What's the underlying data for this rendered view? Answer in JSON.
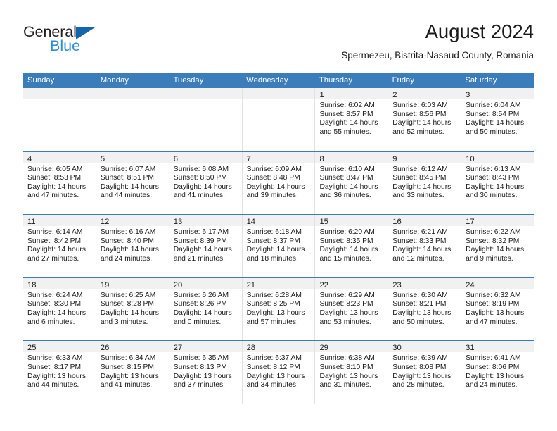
{
  "brand": {
    "name_primary": "General",
    "name_secondary": "Blue",
    "accent_color": "#2e8bd4",
    "triangle_color": "#1565ad"
  },
  "header": {
    "title": "August 2024",
    "subtitle": "Spermezeu, Bistrita-Nasaud County, Romania"
  },
  "calendar": {
    "header_bg": "#3b7cba",
    "header_text_color": "#ffffff",
    "daynum_band_bg": "#f1f1f1",
    "weekdays": [
      "Sunday",
      "Monday",
      "Tuesday",
      "Wednesday",
      "Thursday",
      "Friday",
      "Saturday"
    ],
    "weeks": [
      [
        {
          "day": "",
          "lines": []
        },
        {
          "day": "",
          "lines": []
        },
        {
          "day": "",
          "lines": []
        },
        {
          "day": "",
          "lines": []
        },
        {
          "day": "1",
          "lines": [
            "Sunrise: 6:02 AM",
            "Sunset: 8:57 PM",
            "Daylight: 14 hours",
            "and 55 minutes."
          ]
        },
        {
          "day": "2",
          "lines": [
            "Sunrise: 6:03 AM",
            "Sunset: 8:56 PM",
            "Daylight: 14 hours",
            "and 52 minutes."
          ]
        },
        {
          "day": "3",
          "lines": [
            "Sunrise: 6:04 AM",
            "Sunset: 8:54 PM",
            "Daylight: 14 hours",
            "and 50 minutes."
          ]
        }
      ],
      [
        {
          "day": "4",
          "lines": [
            "Sunrise: 6:05 AM",
            "Sunset: 8:53 PM",
            "Daylight: 14 hours",
            "and 47 minutes."
          ]
        },
        {
          "day": "5",
          "lines": [
            "Sunrise: 6:07 AM",
            "Sunset: 8:51 PM",
            "Daylight: 14 hours",
            "and 44 minutes."
          ]
        },
        {
          "day": "6",
          "lines": [
            "Sunrise: 6:08 AM",
            "Sunset: 8:50 PM",
            "Daylight: 14 hours",
            "and 41 minutes."
          ]
        },
        {
          "day": "7",
          "lines": [
            "Sunrise: 6:09 AM",
            "Sunset: 8:48 PM",
            "Daylight: 14 hours",
            "and 39 minutes."
          ]
        },
        {
          "day": "8",
          "lines": [
            "Sunrise: 6:10 AM",
            "Sunset: 8:47 PM",
            "Daylight: 14 hours",
            "and 36 minutes."
          ]
        },
        {
          "day": "9",
          "lines": [
            "Sunrise: 6:12 AM",
            "Sunset: 8:45 PM",
            "Daylight: 14 hours",
            "and 33 minutes."
          ]
        },
        {
          "day": "10",
          "lines": [
            "Sunrise: 6:13 AM",
            "Sunset: 8:43 PM",
            "Daylight: 14 hours",
            "and 30 minutes."
          ]
        }
      ],
      [
        {
          "day": "11",
          "lines": [
            "Sunrise: 6:14 AM",
            "Sunset: 8:42 PM",
            "Daylight: 14 hours",
            "and 27 minutes."
          ]
        },
        {
          "day": "12",
          "lines": [
            "Sunrise: 6:16 AM",
            "Sunset: 8:40 PM",
            "Daylight: 14 hours",
            "and 24 minutes."
          ]
        },
        {
          "day": "13",
          "lines": [
            "Sunrise: 6:17 AM",
            "Sunset: 8:39 PM",
            "Daylight: 14 hours",
            "and 21 minutes."
          ]
        },
        {
          "day": "14",
          "lines": [
            "Sunrise: 6:18 AM",
            "Sunset: 8:37 PM",
            "Daylight: 14 hours",
            "and 18 minutes."
          ]
        },
        {
          "day": "15",
          "lines": [
            "Sunrise: 6:20 AM",
            "Sunset: 8:35 PM",
            "Daylight: 14 hours",
            "and 15 minutes."
          ]
        },
        {
          "day": "16",
          "lines": [
            "Sunrise: 6:21 AM",
            "Sunset: 8:33 PM",
            "Daylight: 14 hours",
            "and 12 minutes."
          ]
        },
        {
          "day": "17",
          "lines": [
            "Sunrise: 6:22 AM",
            "Sunset: 8:32 PM",
            "Daylight: 14 hours",
            "and 9 minutes."
          ]
        }
      ],
      [
        {
          "day": "18",
          "lines": [
            "Sunrise: 6:24 AM",
            "Sunset: 8:30 PM",
            "Daylight: 14 hours",
            "and 6 minutes."
          ]
        },
        {
          "day": "19",
          "lines": [
            "Sunrise: 6:25 AM",
            "Sunset: 8:28 PM",
            "Daylight: 14 hours",
            "and 3 minutes."
          ]
        },
        {
          "day": "20",
          "lines": [
            "Sunrise: 6:26 AM",
            "Sunset: 8:26 PM",
            "Daylight: 14 hours",
            "and 0 minutes."
          ]
        },
        {
          "day": "21",
          "lines": [
            "Sunrise: 6:28 AM",
            "Sunset: 8:25 PM",
            "Daylight: 13 hours",
            "and 57 minutes."
          ]
        },
        {
          "day": "22",
          "lines": [
            "Sunrise: 6:29 AM",
            "Sunset: 8:23 PM",
            "Daylight: 13 hours",
            "and 53 minutes."
          ]
        },
        {
          "day": "23",
          "lines": [
            "Sunrise: 6:30 AM",
            "Sunset: 8:21 PM",
            "Daylight: 13 hours",
            "and 50 minutes."
          ]
        },
        {
          "day": "24",
          "lines": [
            "Sunrise: 6:32 AM",
            "Sunset: 8:19 PM",
            "Daylight: 13 hours",
            "and 47 minutes."
          ]
        }
      ],
      [
        {
          "day": "25",
          "lines": [
            "Sunrise: 6:33 AM",
            "Sunset: 8:17 PM",
            "Daylight: 13 hours",
            "and 44 minutes."
          ]
        },
        {
          "day": "26",
          "lines": [
            "Sunrise: 6:34 AM",
            "Sunset: 8:15 PM",
            "Daylight: 13 hours",
            "and 41 minutes."
          ]
        },
        {
          "day": "27",
          "lines": [
            "Sunrise: 6:35 AM",
            "Sunset: 8:13 PM",
            "Daylight: 13 hours",
            "and 37 minutes."
          ]
        },
        {
          "day": "28",
          "lines": [
            "Sunrise: 6:37 AM",
            "Sunset: 8:12 PM",
            "Daylight: 13 hours",
            "and 34 minutes."
          ]
        },
        {
          "day": "29",
          "lines": [
            "Sunrise: 6:38 AM",
            "Sunset: 8:10 PM",
            "Daylight: 13 hours",
            "and 31 minutes."
          ]
        },
        {
          "day": "30",
          "lines": [
            "Sunrise: 6:39 AM",
            "Sunset: 8:08 PM",
            "Daylight: 13 hours",
            "and 28 minutes."
          ]
        },
        {
          "day": "31",
          "lines": [
            "Sunrise: 6:41 AM",
            "Sunset: 8:06 PM",
            "Daylight: 13 hours",
            "and 24 minutes."
          ]
        }
      ]
    ]
  }
}
